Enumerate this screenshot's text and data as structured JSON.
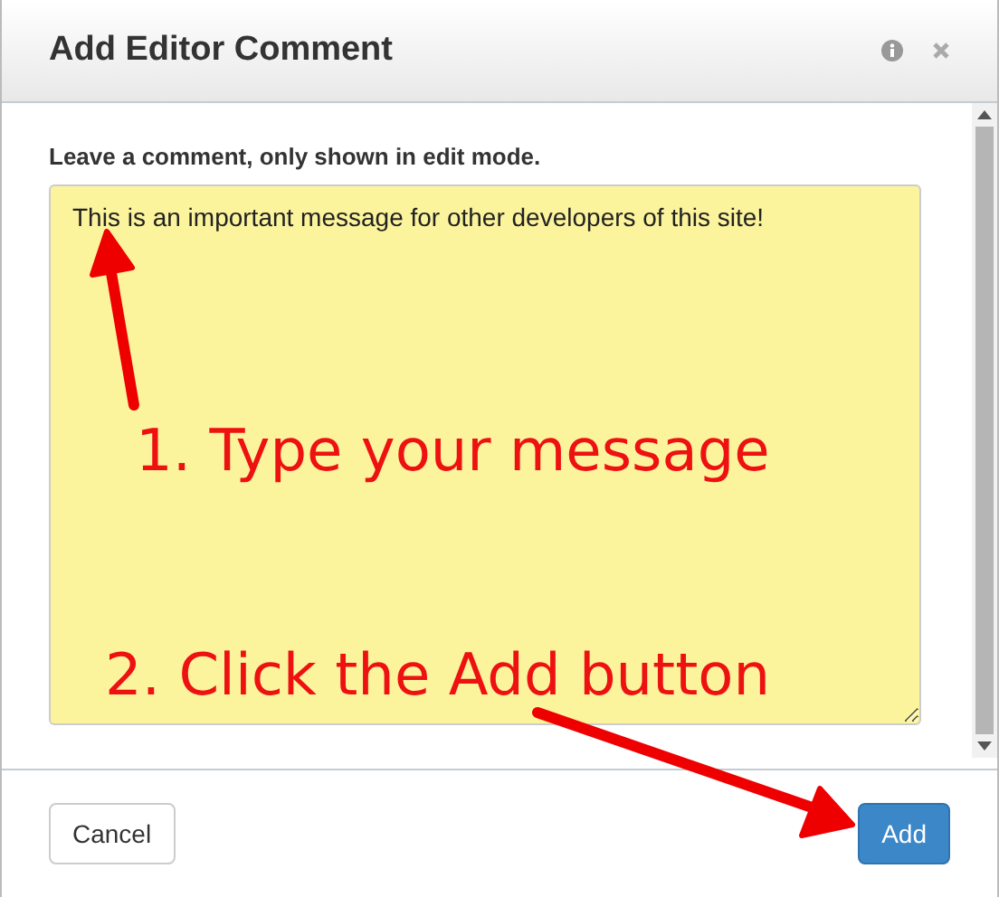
{
  "dialog": {
    "title": "Add Editor Comment",
    "label": "Leave a comment, only shown in edit mode.",
    "comment": {
      "value": "This is an important message for other developers of this site!"
    },
    "buttons": [
      {
        "label": "Cancel",
        "kind": "default"
      },
      {
        "label": "Add",
        "kind": "primary"
      }
    ]
  },
  "annotations": [
    {
      "text": "1. Type your message"
    },
    {
      "text": "2. Click the Add button"
    }
  ]
}
